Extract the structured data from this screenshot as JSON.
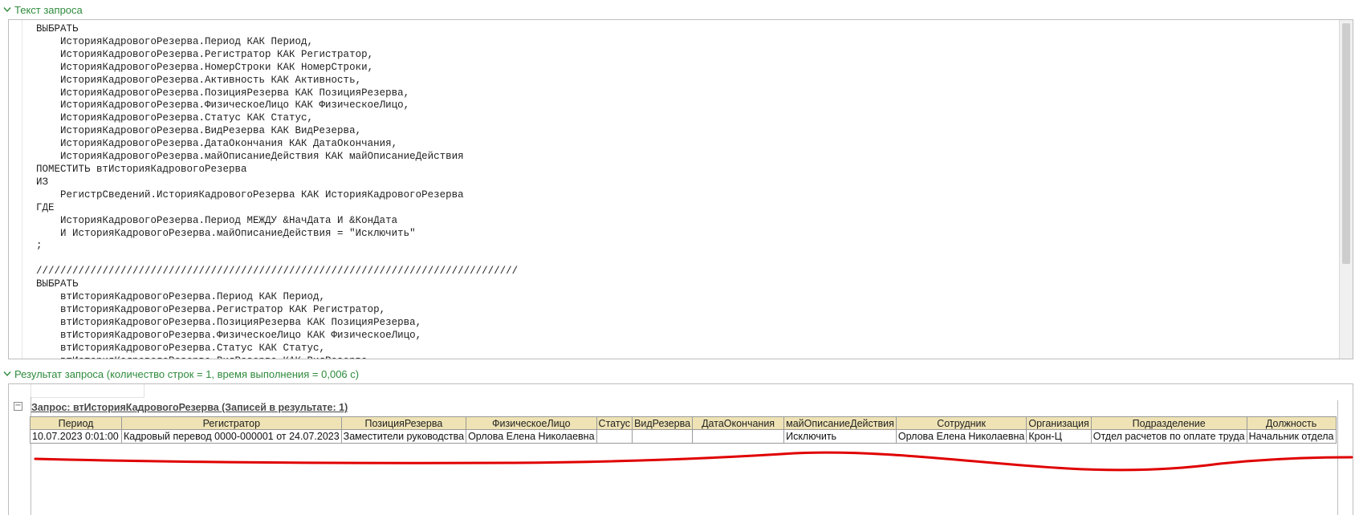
{
  "query_section": {
    "title": "Текст запроса"
  },
  "query_text": "ВЫБРАТЬ\n    ИсторияКадровогоРезерва.Период КАК Период,\n    ИсторияКадровогоРезерва.Регистратор КАК Регистратор,\n    ИсторияКадровогоРезерва.НомерСтроки КАК НомерСтроки,\n    ИсторияКадровогоРезерва.Активность КАК Активность,\n    ИсторияКадровогоРезерва.ПозицияРезерва КАК ПозицияРезерва,\n    ИсторияКадровогоРезерва.ФизическоеЛицо КАК ФизическоеЛицо,\n    ИсторияКадровогоРезерва.Статус КАК Статус,\n    ИсторияКадровогоРезерва.ВидРезерва КАК ВидРезерва,\n    ИсторияКадровогоРезерва.ДатаОкончания КАК ДатаОкончания,\n    ИсторияКадровогоРезерва.майОписаниеДействия КАК майОписаниеДействия\nПОМЕСТИТЬ втИсторияКадровогоРезерва\nИЗ\n    РегистрСведений.ИсторияКадровогоРезерва КАК ИсторияКадровогоРезерва\nГДЕ\n    ИсторияКадровогоРезерва.Период МЕЖДУ &НачДата И &КонДата\n    И ИсторияКадровогоРезерва.майОписаниеДействия = \"Исключить\"\n;\n\n////////////////////////////////////////////////////////////////////////////////\nВЫБРАТЬ\n    втИсторияКадровогоРезерва.Период КАК Период,\n    втИсторияКадровогоРезерва.Регистратор КАК Регистратор,\n    втИсторияКадровогоРезерва.ПозицияРезерва КАК ПозицияРезерва,\n    втИсторияКадровогоРезерва.ФизическоеЛицо КАК ФизическоеЛицо,\n    втИсторияКадровогоРезерва.Статус КАК Статус,\n    втИсторияКадровогоРезерва.ВидРезерва КАК ВидРезерва,",
  "result_section": {
    "title": "Результат запроса (количество строк = 1, время выполнения = 0,006 с)"
  },
  "result_table": {
    "caption": "Запрос: втИсторияКадровогоРезерва (Записей в результате: 1)",
    "columns": [
      "Период",
      "Регистратор",
      "ПозицияРезерва",
      "ФизическоеЛицо",
      "Статус",
      "ВидРезерва",
      "ДатаОкончания",
      "майОписаниеДействия",
      "Сотрудник",
      "Организация",
      "Подразделение",
      "Должность"
    ],
    "rows": [
      [
        "10.07.2023 0:01:00",
        "Кадровый перевод 0000-000001 от 24.07.2023",
        "Заместители руководства",
        "Орлова Елена Николаевна",
        "",
        "",
        "",
        "Исключить",
        "Орлова Елена Николаевна",
        "Крон-Ц",
        "Отдел расчетов по оплате труда",
        "Начальник отдела"
      ]
    ]
  },
  "colors": {
    "section_title": "#2e8b3c",
    "header_bg": "#efe3b5",
    "annotation": "#e00000"
  }
}
